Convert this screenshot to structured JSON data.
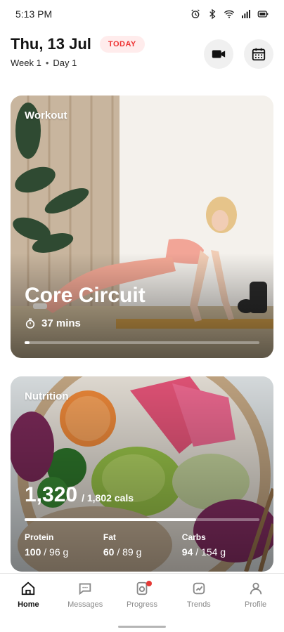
{
  "status_bar": {
    "time": "5:13 PM",
    "icons": [
      "alarm-icon",
      "bluetooth-icon",
      "wifi-icon",
      "signal-icon",
      "battery-icon"
    ]
  },
  "header": {
    "date": "Thu, 13 Jul",
    "today_badge": "TODAY",
    "week": "Week 1",
    "day": "Day 1",
    "video_icon": "video-camera-icon",
    "calendar_icon": "calendar-icon"
  },
  "workout": {
    "label": "Workout",
    "title": "Core Circuit",
    "duration": "37 mins",
    "progress": 0.02
  },
  "nutrition": {
    "label": "Nutrition",
    "calories_consumed": "1,320",
    "calories_total": "/ 1,802 cals",
    "calorie_progress": 0.73,
    "macros": [
      {
        "label": "Protein",
        "value": "100",
        "total": "/ 96 g"
      },
      {
        "label": "Fat",
        "value": "60",
        "total": "/ 89 g"
      },
      {
        "label": "Carbs",
        "value": "94",
        "total": "/ 154 g"
      }
    ]
  },
  "nav": {
    "items": [
      {
        "label": "Home",
        "icon": "home-icon",
        "active": true
      },
      {
        "label": "Messages",
        "icon": "chat-icon",
        "active": false
      },
      {
        "label": "Progress",
        "icon": "camera-icon",
        "active": false
      },
      {
        "label": "Trends",
        "icon": "trend-icon",
        "active": false
      },
      {
        "label": "Profile",
        "icon": "user-icon",
        "active": false
      }
    ]
  },
  "colors": {
    "accent_red": "#e33333",
    "today_bg": "#ffecec",
    "text_dark": "#151515"
  }
}
